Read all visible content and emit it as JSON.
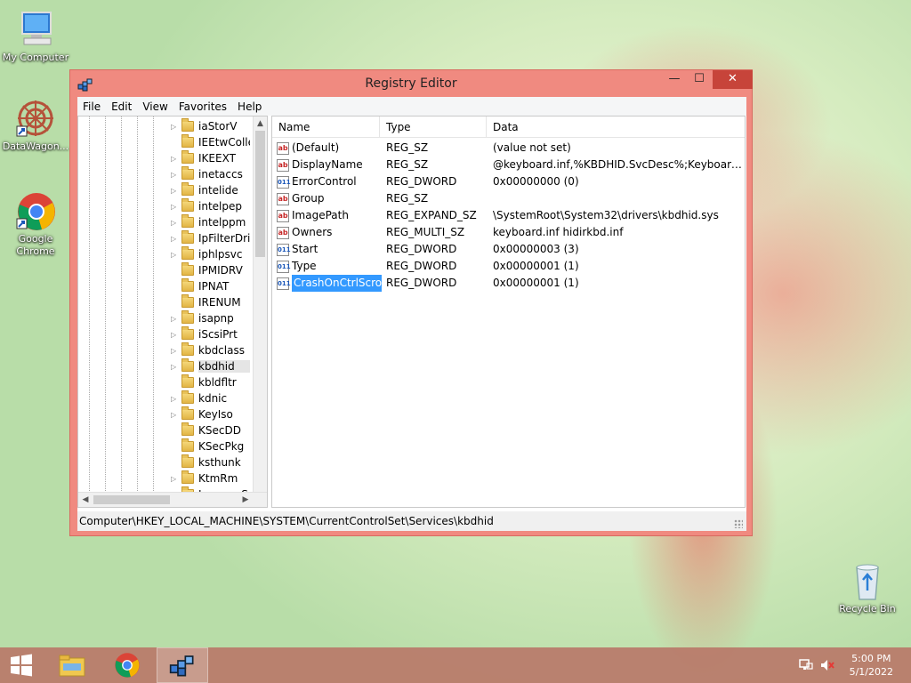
{
  "desktop": {
    "icons": [
      {
        "label": "My Computer"
      },
      {
        "label": "DataWagon..."
      },
      {
        "label": "Google Chrome"
      },
      {
        "label": "Recycle Bin"
      }
    ]
  },
  "window": {
    "title": "Registry Editor",
    "controls": {
      "minimize": "—",
      "maximize": "☐",
      "close": "✕"
    }
  },
  "menu": [
    "File",
    "Edit",
    "View",
    "Favorites",
    "Help"
  ],
  "tree": {
    "items": [
      {
        "label": "iaStorV",
        "expandable": true
      },
      {
        "label": "IEEtwCollectorService",
        "expandable": false
      },
      {
        "label": "IKEEXT",
        "expandable": true
      },
      {
        "label": "inetaccs",
        "expandable": true
      },
      {
        "label": "intelide",
        "expandable": true
      },
      {
        "label": "intelpep",
        "expandable": true
      },
      {
        "label": "intelppm",
        "expandable": true
      },
      {
        "label": "IpFilterDriver",
        "expandable": true
      },
      {
        "label": "iphlpsvc",
        "expandable": true
      },
      {
        "label": "IPMIDRV",
        "expandable": false
      },
      {
        "label": "IPNAT",
        "expandable": false
      },
      {
        "label": "IRENUM",
        "expandable": false
      },
      {
        "label": "isapnp",
        "expandable": true
      },
      {
        "label": "iScsiPrt",
        "expandable": true
      },
      {
        "label": "kbdclass",
        "expandable": true
      },
      {
        "label": "kbdhid",
        "expandable": true,
        "selected": true
      },
      {
        "label": "kbldfltr",
        "expandable": false
      },
      {
        "label": "kdnic",
        "expandable": true
      },
      {
        "label": "KeyIso",
        "expandable": true
      },
      {
        "label": "KSecDD",
        "expandable": false
      },
      {
        "label": "KSecPkg",
        "expandable": false
      },
      {
        "label": "ksthunk",
        "expandable": false
      },
      {
        "label": "KtmRm",
        "expandable": true
      },
      {
        "label": "LanmanServer",
        "expandable": true
      }
    ]
  },
  "list": {
    "columns": {
      "name": "Name",
      "type": "Type",
      "data": "Data"
    },
    "rows": [
      {
        "icon": "ab",
        "name": "(Default)",
        "type": "REG_SZ",
        "data": "(value not set)"
      },
      {
        "icon": "ab",
        "name": "DisplayName",
        "type": "REG_SZ",
        "data": "@keyboard.inf,%KBDHID.SvcDesc%;Keyboard HID ..."
      },
      {
        "icon": "011",
        "name": "ErrorControl",
        "type": "REG_DWORD",
        "data": "0x00000000 (0)"
      },
      {
        "icon": "ab",
        "name": "Group",
        "type": "REG_SZ",
        "data": ""
      },
      {
        "icon": "ab",
        "name": "ImagePath",
        "type": "REG_EXPAND_SZ",
        "data": "\\SystemRoot\\System32\\drivers\\kbdhid.sys"
      },
      {
        "icon": "ab",
        "name": "Owners",
        "type": "REG_MULTI_SZ",
        "data": "keyboard.inf hidirkbd.inf"
      },
      {
        "icon": "011",
        "name": "Start",
        "type": "REG_DWORD",
        "data": "0x00000003 (3)"
      },
      {
        "icon": "011",
        "name": "Type",
        "type": "REG_DWORD",
        "data": "0x00000001 (1)"
      },
      {
        "icon": "011",
        "name": "CrashOnCtrlScroll",
        "type": "REG_DWORD",
        "data": "0x00000001 (1)",
        "selected": true
      }
    ]
  },
  "status": {
    "path": "Computer\\HKEY_LOCAL_MACHINE\\SYSTEM\\CurrentControlSet\\Services\\kbdhid"
  },
  "taskbar": {
    "clock": {
      "time": "5:00 PM",
      "date": "5/1/2022"
    }
  },
  "colors": {
    "window_frame": "#f08a80",
    "close_button": "#c7443a",
    "selection": "#3399ff"
  }
}
